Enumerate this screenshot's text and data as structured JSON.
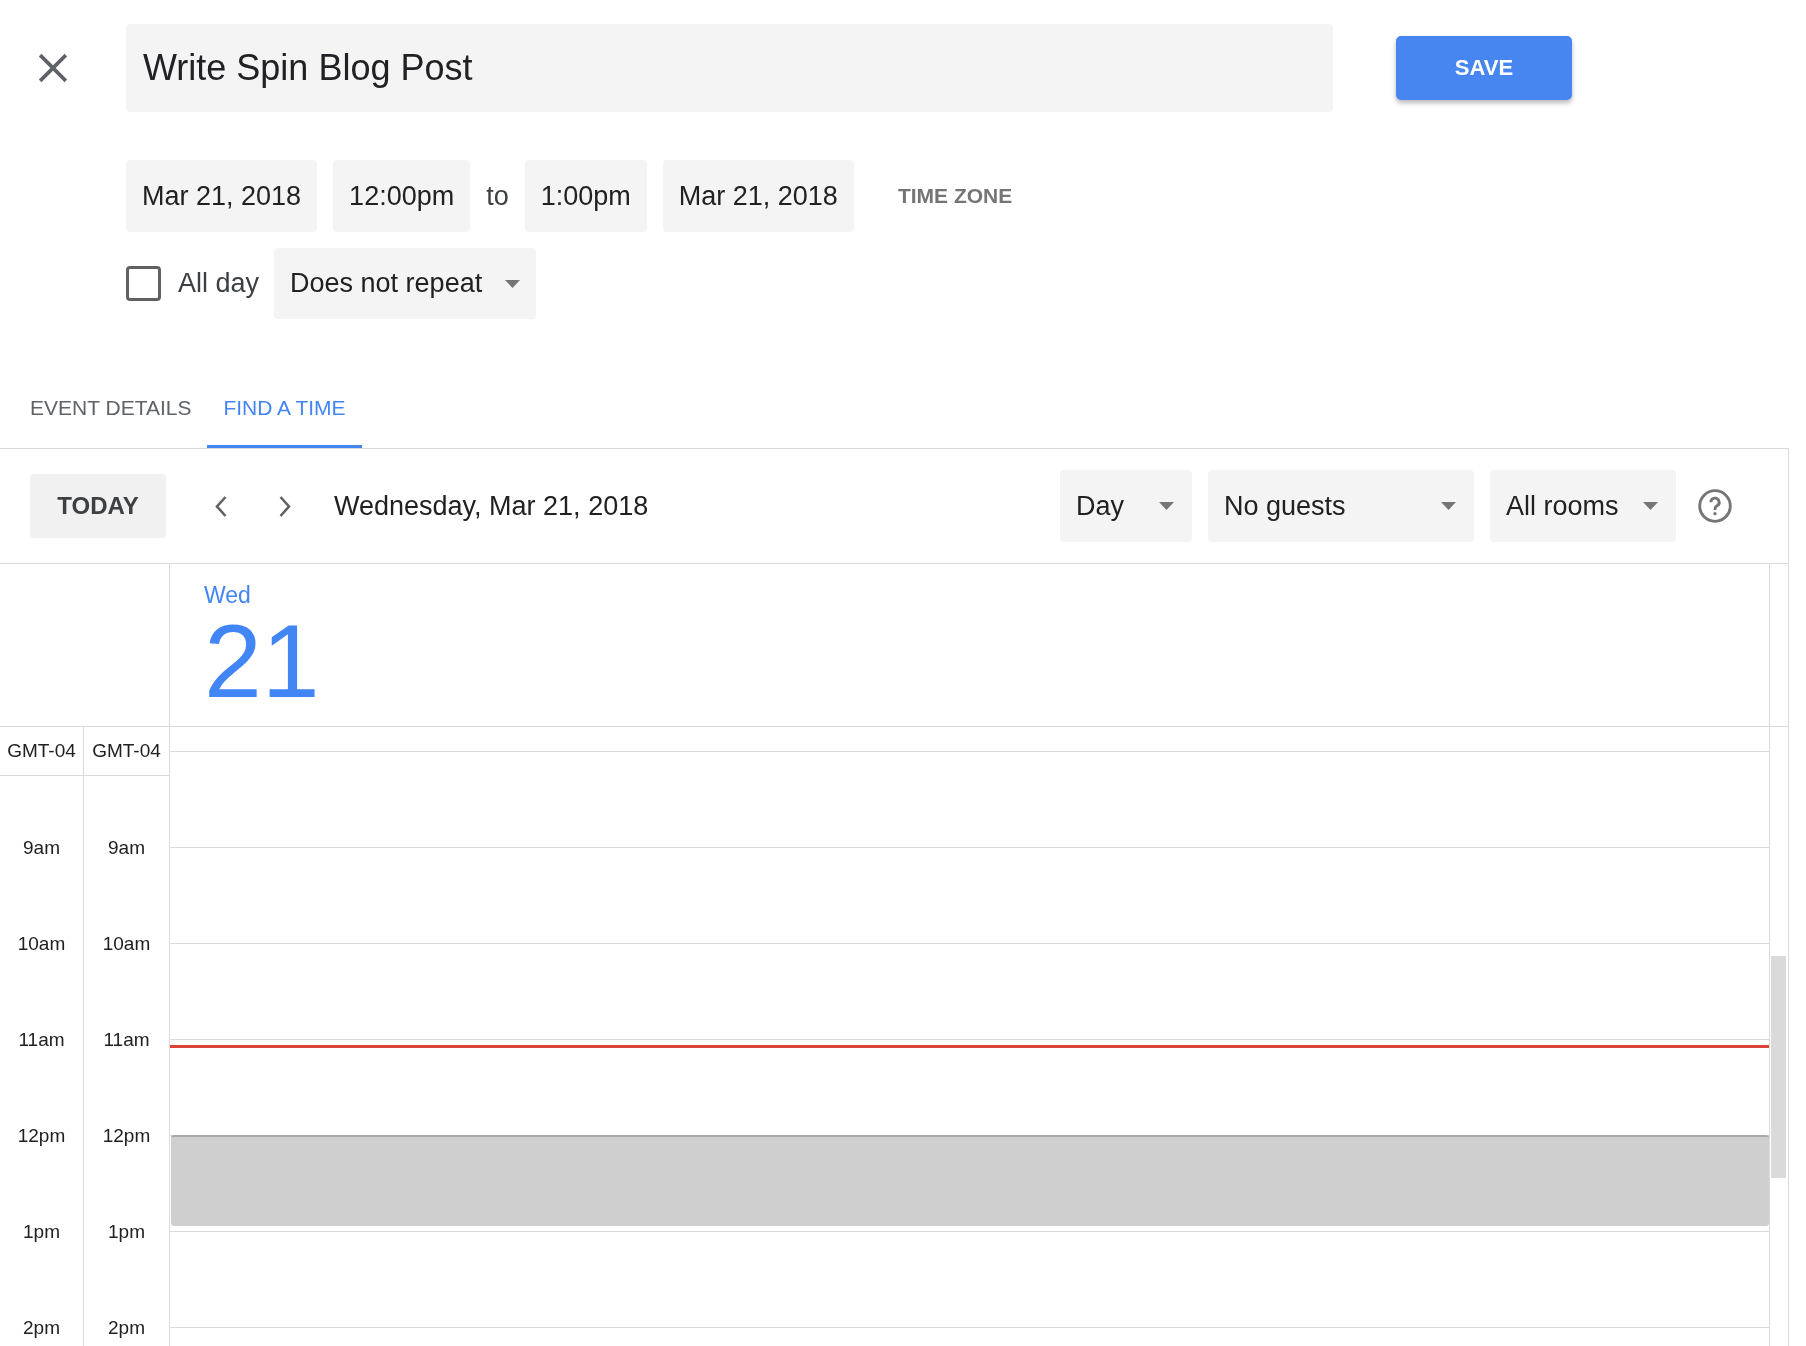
{
  "header": {
    "title": "Write Spin Blog Post",
    "save_button": "SAVE"
  },
  "when": {
    "start_date": "Mar 21, 2018",
    "start_time": "12:00pm",
    "separator": "to",
    "end_time": "1:00pm",
    "end_date": "Mar 21, 2018",
    "time_zone_button": "TIME ZONE"
  },
  "options": {
    "all_day": {
      "label": "All day",
      "checked": false
    },
    "repeat": "Does not repeat"
  },
  "tabs": [
    {
      "label": "EVENT DETAILS",
      "selected": false
    },
    {
      "label": "FIND A TIME",
      "selected": true
    }
  ],
  "find_a_time": {
    "toolbar": {
      "today_button": "TODAY",
      "date": "Wednesday, Mar 21, 2018",
      "dropdowns": [
        "Day",
        "No guests",
        "All rooms"
      ]
    },
    "day_header": {
      "weekday": "Wed",
      "day": "21"
    },
    "time_zones": [
      {
        "label": "GMT-04",
        "hours": [
          "9am",
          "10am",
          "11am",
          "12pm",
          "1pm",
          "2pm"
        ]
      },
      {
        "label": "GMT-04",
        "hours": [
          "9am",
          "10am",
          "11am",
          "12pm",
          "1pm",
          "2pm"
        ]
      }
    ]
  }
}
